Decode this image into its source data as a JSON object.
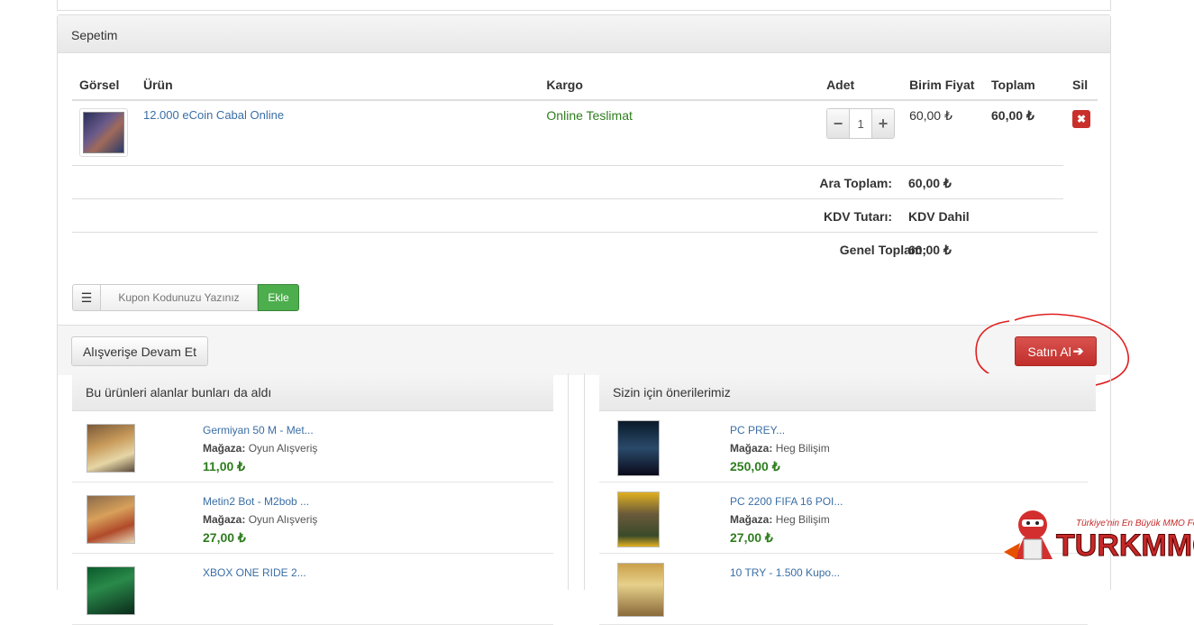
{
  "cart": {
    "title": "Sepetim",
    "columns": [
      "Görsel",
      "Ürün",
      "Kargo",
      "Adet",
      "Birim Fiyat",
      "Toplam",
      "Sil"
    ],
    "item": {
      "name": "12.000 eCoin Cabal Online",
      "shipping": "Online Teslimat",
      "quantity": "1",
      "unit_price": "60,00 ₺",
      "total": "60,00 ₺"
    },
    "summary": [
      {
        "label": "Ara Toplam:",
        "value": "60,00 ₺"
      },
      {
        "label": "KDV Tutarı:",
        "value": "KDV Dahil"
      },
      {
        "label": "Genel Toplam:",
        "value": "60,00 ₺"
      }
    ],
    "coupon_placeholder": "Kupon Kodunuzu Yazınız",
    "coupon_add": "Ekle",
    "continue_label": "Alışverişe Devam Et",
    "buy_label": "Satın Al"
  },
  "left_recs": {
    "title": "Bu ürünleri alanlar bunları da aldı",
    "items": [
      {
        "name": "Germiyan 50 M - Met...",
        "shop_label": "Mağaza:",
        "shop": "Oyun Alışveriş",
        "price": "11,00 ₺"
      },
      {
        "name": "Metin2 Bot - M2bob ...",
        "shop_label": "Mağaza:",
        "shop": "Oyun Alışveriş",
        "price": "27,00 ₺"
      },
      {
        "name": "XBOX ONE RIDE 2...",
        "shop_label": "",
        "shop": "",
        "price": ""
      }
    ]
  },
  "right_recs": {
    "title": "Sizin için önerilerimiz",
    "items": [
      {
        "name": "PC PREY...",
        "shop_label": "Mağaza:",
        "shop": "Heg Bilişim",
        "price": "250,00 ₺"
      },
      {
        "name": "PC 2200 FIFA 16 POI...",
        "shop_label": "Mağaza:",
        "shop": "Heg Bilişim",
        "price": "27,00 ₺"
      },
      {
        "name": "10 TRY - 1.500 Kupo...",
        "shop_label": "",
        "shop": "",
        "price": ""
      }
    ]
  },
  "watermark": {
    "tagline": "Türkiye'nin En Büyük MMO Forumu",
    "logo": "TURKMMO"
  },
  "colors": {
    "link": "#3a6ea5",
    "price": "#2e7d1e",
    "danger": "#d9534f",
    "success": "#4cae4c"
  }
}
